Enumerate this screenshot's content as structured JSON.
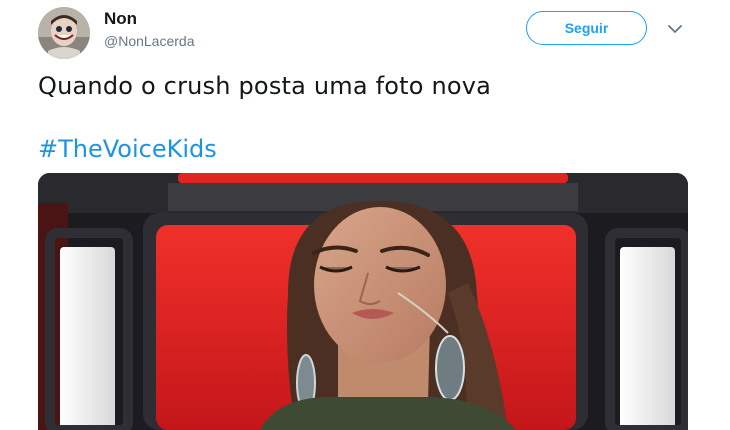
{
  "tweet": {
    "author": {
      "name": "Non",
      "handle": "@NonLacerda",
      "avatar_icon": "avatar-child-face"
    },
    "follow_label": "Seguir",
    "menu_icon": "chevron-down-icon",
    "text": "Quando o crush posta uma foto nova",
    "hashtag": "#TheVoiceKids",
    "media": {
      "description_icon": "photo",
      "alt": ""
    }
  },
  "colors": {
    "accent": "#1da1f2",
    "hashtag": "#1b95e0",
    "text": "#14171a",
    "muted": "#657786",
    "chair_red": "#e0241f"
  }
}
